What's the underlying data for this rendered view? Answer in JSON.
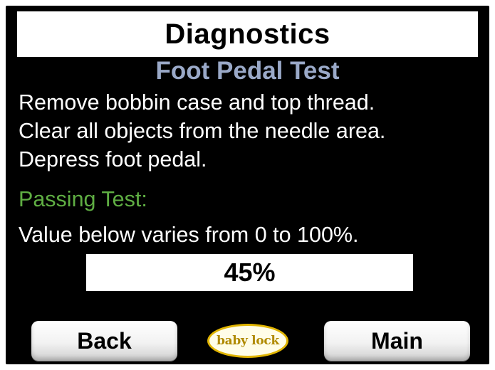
{
  "header": {
    "title": "Diagnostics",
    "subtitle": "Foot Pedal Test"
  },
  "instructions": {
    "lines": [
      "Remove bobbin case and top thread.",
      "Clear all objects from the needle area.",
      "Depress foot pedal."
    ]
  },
  "passing": {
    "label": "Passing Test:",
    "description": "Value below varies from 0 to 100%."
  },
  "value": {
    "display": "45%"
  },
  "buttons": {
    "back_label": "Back",
    "main_label": "Main"
  },
  "logo": {
    "text": "baby lock",
    "icon": "baby-lock-logo"
  },
  "colors": {
    "screen_bg": "#000000",
    "subtitle": "#9aa9c8",
    "passing": "#5fae43",
    "logo_ring": "#e0b400"
  }
}
